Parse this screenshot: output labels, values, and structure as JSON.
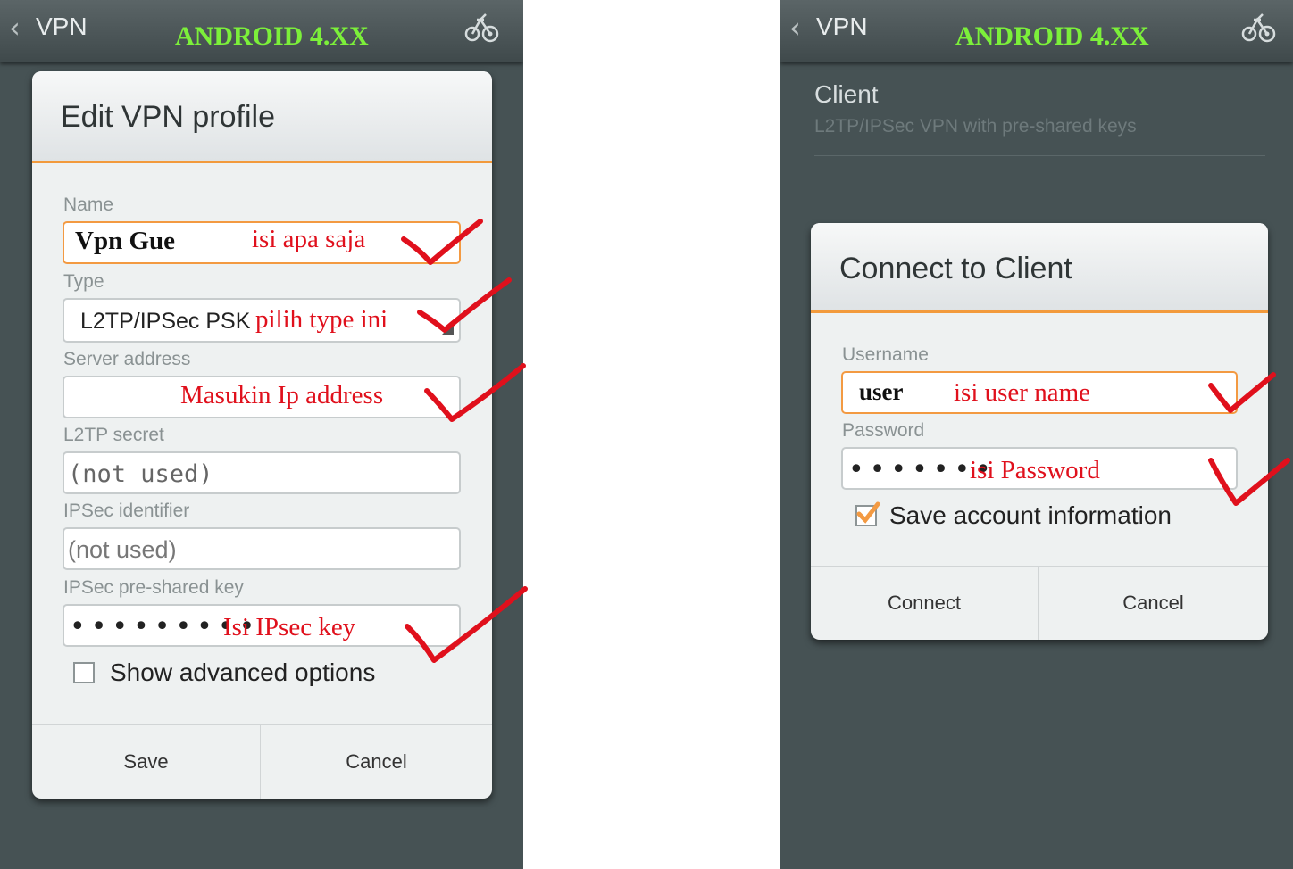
{
  "left_screen": {
    "action_bar": {
      "back_icon": "chevron-left-icon",
      "title": "VPN",
      "tag": "ANDROID 4.XX",
      "action_icon": "bike-icon"
    },
    "dialog": {
      "title": "Edit VPN profile",
      "name": {
        "label": "Name",
        "value": "Vpn  Gue",
        "annotation": "isi apa saja"
      },
      "type": {
        "label": "Type",
        "value": "L2TP/IPSec PSK",
        "annotation": "pilih  type ini"
      },
      "server": {
        "label": "Server address",
        "value": "",
        "annotation": "Masukin Ip address"
      },
      "l2tp_secret": {
        "label": "L2TP secret",
        "placeholder": "(not used)"
      },
      "ipsec_identifier": {
        "label": "IPSec identifier",
        "placeholder": "(not used)"
      },
      "ipsec_key": {
        "label": "IPSec pre-shared key",
        "masked": "•••••••••",
        "annotation": "Isi IPsec key"
      },
      "advanced": {
        "label": "Show advanced options",
        "checked": false
      },
      "buttons": {
        "save": "Save",
        "cancel": "Cancel"
      }
    }
  },
  "right_screen": {
    "action_bar": {
      "back_icon": "chevron-left-icon",
      "title": "VPN",
      "tag": "ANDROID 4.XX",
      "action_icon": "bike-icon"
    },
    "list_item": {
      "title": "Client",
      "subtitle": "L2TP/IPSec VPN with pre-shared keys"
    },
    "dialog": {
      "title": "Connect to Client",
      "username": {
        "label": "Username",
        "value": "user",
        "annotation": "isi user name"
      },
      "password": {
        "label": "Password",
        "masked": "•••••••",
        "annotation": "isi Password"
      },
      "save_account": {
        "label": "Save account information",
        "checked": true
      },
      "buttons": {
        "connect": "Connect",
        "cancel": "Cancel"
      }
    }
  },
  "colors": {
    "accent_orange": "#f39a42",
    "annotation_red": "#e0101c",
    "tag_green": "#7cf03a",
    "screen_bg": "#465254"
  }
}
